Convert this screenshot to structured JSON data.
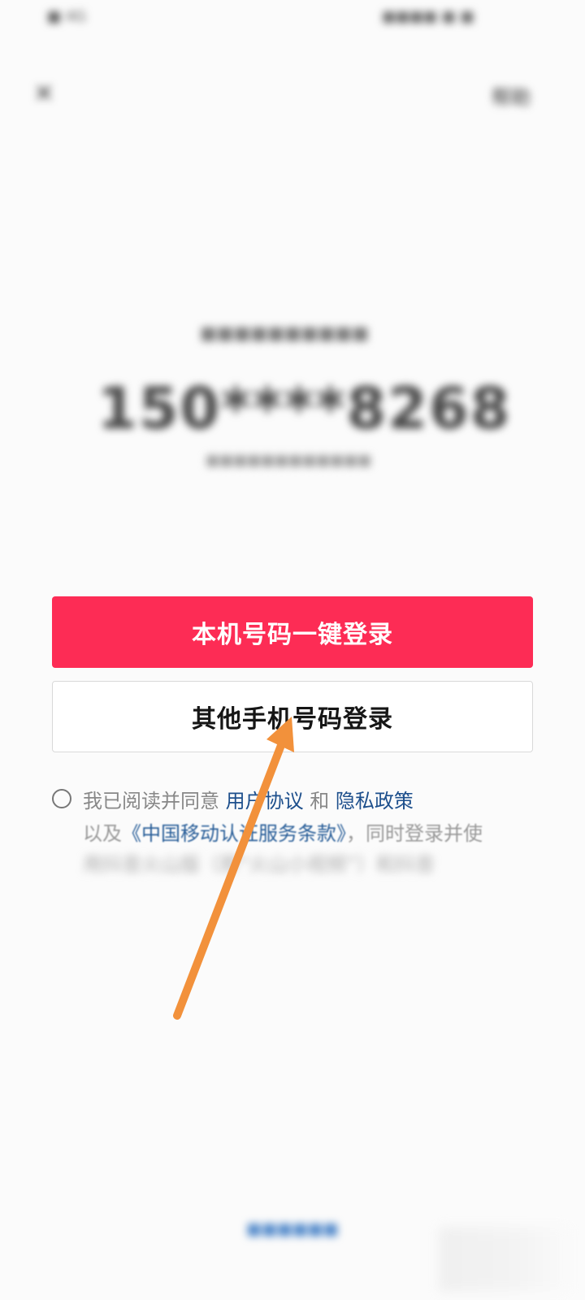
{
  "status_bar": {
    "left_text": "■ 4G",
    "left_accent": "4G",
    "right_text": "■■■■ ■ ■"
  },
  "header": {
    "close_icon": "close-icon",
    "help_label": "帮助"
  },
  "main": {
    "prompt_text": "■■■■■■■■■■",
    "phone_number": "150****8268",
    "carrier_text": "■■■■■■■■■■■■"
  },
  "actions": {
    "primary_label": "本机号码一键登录",
    "secondary_label": "其他手机号码登录"
  },
  "agreement": {
    "line1_prefix": "我已阅读并同意 ",
    "user_agreement": "用户协议",
    "and": " 和 ",
    "privacy_policy": "隐私政策",
    "line2_prefix": "以及",
    "cmcc_terms": "《中国移动认证服务条款》",
    "line2_suffix": "，同时登录并使",
    "line3_text": "用抖音火山版（原“火山小视频”）和抖音"
  },
  "footer": {
    "bottom_link": "■■■■■■"
  },
  "colors": {
    "primary": "#fd2c55",
    "link": "#1d4f8c",
    "arrow": "#f2913b"
  }
}
